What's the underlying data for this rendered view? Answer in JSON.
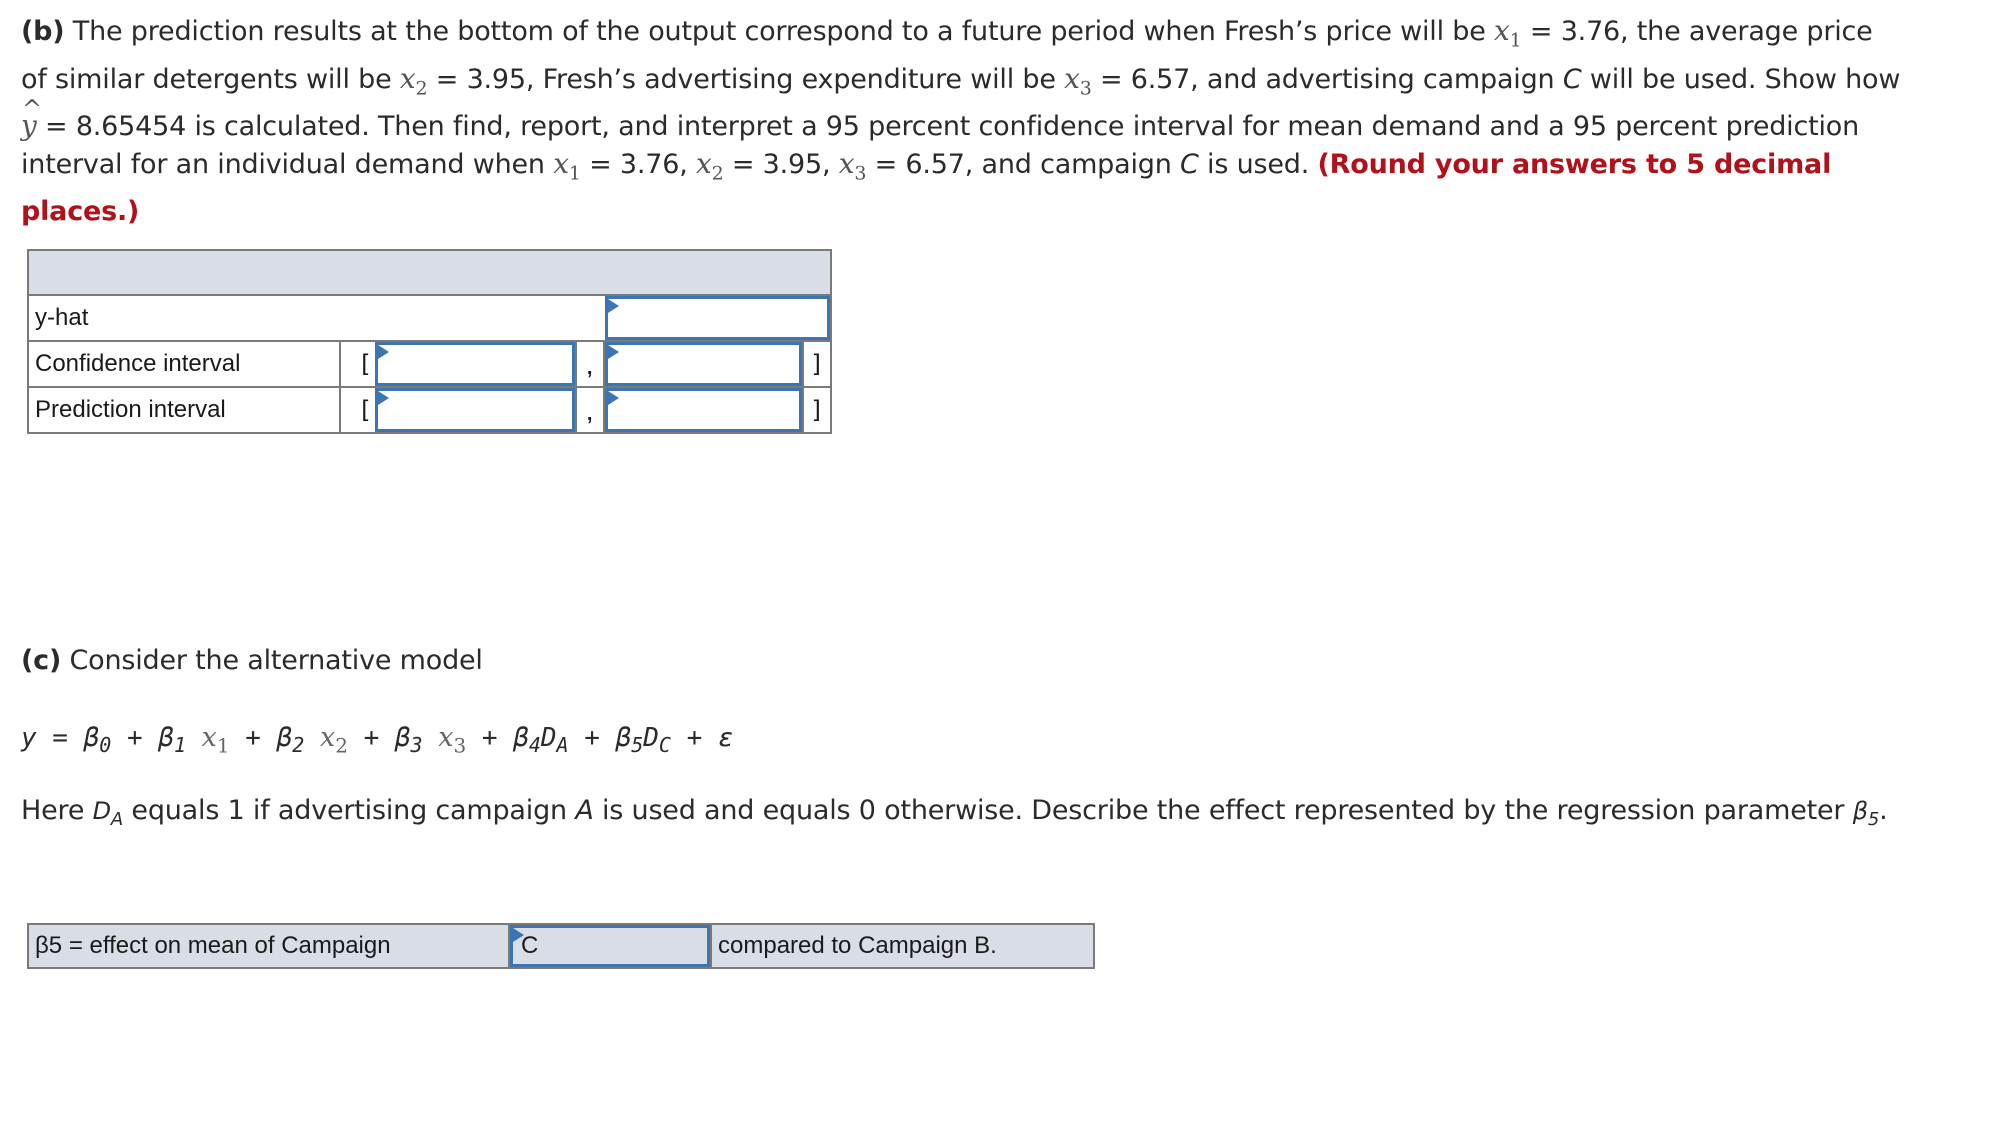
{
  "part_b": {
    "label": "(b)",
    "seg1": " The prediction results at the bottom of the output correspond to a future period when Fresh’s price will be ",
    "x1_var": "x",
    "x1_sub": "1",
    "seg2": " = 3.76, the average price of similar detergents will be ",
    "x2_var": "x",
    "x2_sub": "2",
    "seg3": " = 3.95, Fresh’s advertising expenditure will be ",
    "x3_var": "x",
    "x3_sub": "3",
    "seg4": " = 6.57, and advertising campaign ",
    "campaign_c": "C",
    "seg5": " will be used. Show how ",
    "yhat_var": "y",
    "yhat_hat": "^",
    "seg6": " = 8.65454 is calculated. Then find, report, and interpret a 95 percent confidence interval for mean demand and a 95 percent prediction interval for an individual demand when ",
    "seg7": " = 3.76, ",
    "seg8": " = 3.95, ",
    "seg9": " = 6.57, and campaign ",
    "seg10": " is used. ",
    "instruction": "(Round your answers to 5 decimal places.)"
  },
  "table1": {
    "rows": [
      {
        "label": "y-hat",
        "value": ""
      },
      {
        "label": "Confidence interval",
        "open": "[",
        "lower": "",
        "sep": ",",
        "upper": "",
        "close": "]"
      },
      {
        "label": "Prediction interval",
        "open": "[",
        "lower": "",
        "sep": ",",
        "upper": "",
        "close": "]"
      }
    ]
  },
  "part_c": {
    "label": "(c)",
    "title": " Consider the alternative model",
    "equation": {
      "y": "y",
      "eq": " = ",
      "b0": "β",
      "b0_sub": "0",
      "plus": " + ",
      "b1": "β",
      "b1_sub": "1",
      "x1": "x",
      "x1_sub": "1",
      "b2": "β",
      "b2_sub": "2",
      "x2": "x",
      "x2_sub": "2",
      "b3": "β",
      "b3_sub": "3",
      "x3": "x",
      "x3_sub": "3",
      "b4": "β",
      "b4_sub": "4",
      "da": "D",
      "da_sub": "A",
      "b5": "β",
      "b5_sub": "5",
      "dc": "D",
      "dc_sub": "C",
      "eps": "ε"
    },
    "text_seg1": "Here ",
    "d_var": "D",
    "d_sub": "A",
    "text_seg2": " equals 1 if advertising campaign ",
    "campaign_a": "A",
    "text_seg3": " is used and equals 0 otherwise. Describe the effect represented by the regression parameter ",
    "beta_var": "β",
    "beta_sub": "5",
    "text_end": "."
  },
  "table2": {
    "prefix": "β5 = effect on mean of Campaign",
    "dropdown_value": "C",
    "suffix": "compared to Campaign B."
  },
  "colors": {
    "input_border": "#3c75b4",
    "header_bg": "#d9dde6",
    "instruction_red": "#b0111a"
  }
}
